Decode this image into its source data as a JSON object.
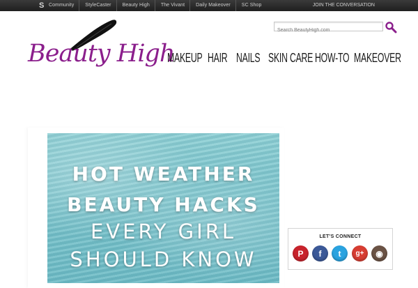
{
  "topbar": {
    "nav": [
      "Community",
      "StyleCaster",
      "Beauty High",
      "The Vivant",
      "Daily Makeover",
      "SC Shop"
    ],
    "join": "JOIN THE CONVERSATION"
  },
  "logo": {
    "text": "Beauty High",
    "brand_color": "#8b1f8c"
  },
  "search": {
    "placeholder": "Search BeautyHigh.com"
  },
  "mainnav": [
    "MAKEUP",
    "HAIR",
    "NAILS",
    "SKIN CARE",
    "HOW-TO",
    "MAKEOVER"
  ],
  "hero": {
    "lines": [
      "HOT WEATHER",
      "BEAUTY HACKS",
      "EVERY GIRL",
      "SHOULD KNOW"
    ]
  },
  "connect": {
    "title": "LET'S CONNECT",
    "networks": [
      {
        "name": "pinterest-icon",
        "glyph": "P",
        "color": "#c8232c"
      },
      {
        "name": "facebook-icon",
        "glyph": "f",
        "color": "#3b5998"
      },
      {
        "name": "twitter-icon",
        "glyph": "t",
        "color": "#2aa3e0"
      },
      {
        "name": "google-plus-icon",
        "glyph": "g+",
        "color": "#d73d32"
      },
      {
        "name": "instagram-icon",
        "glyph": "◉",
        "color": "#6b5345"
      }
    ]
  }
}
